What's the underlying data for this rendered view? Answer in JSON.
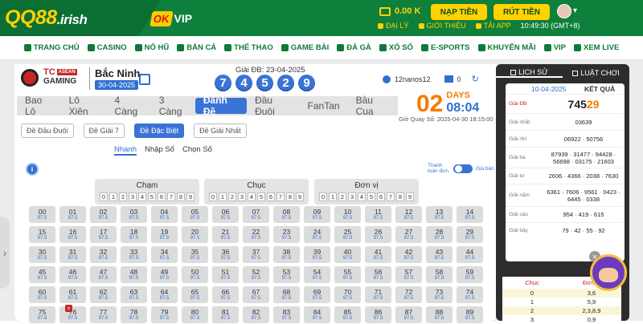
{
  "brand": {
    "name": "QQ88",
    "suffix": ".irish",
    "partner_ok": "OK",
    "partner_vip": "VIP"
  },
  "top": {
    "balance": "0.00 K",
    "deposit": "NẠP TIỀN",
    "withdraw": "RÚT TIỀN"
  },
  "subnav": {
    "agent": "ĐẠI LÝ",
    "intro": "GIỚI THIỆU",
    "app": "TẢI APP",
    "clock": "10:49:30 (GMT+8)"
  },
  "menu": [
    "TRANG CHỦ",
    "CASINO",
    "NỔ HŨ",
    "BẮN CÁ",
    "THỂ THAO",
    "GAME BÀI",
    "ĐÁ GÀ",
    "XỔ SỐ",
    "E-SPORTS",
    "KHUYẾN MÃI",
    "VIP",
    "XEM LIVE"
  ],
  "game": {
    "logo_tc": "TC",
    "logo_asean": "ASEAN",
    "logo_gaming": "GAMING",
    "province": "Bắc Ninh",
    "date": "30-04-2025",
    "prize_label": "Giải ĐB: 23-04-2025",
    "balls": [
      "7",
      "4",
      "5",
      "2",
      "9"
    ]
  },
  "user": {
    "name": "12nanos12",
    "balance": "0"
  },
  "tabs": [
    "Bao Lô",
    "Lô Xiên",
    "4 Càng",
    "3 Càng",
    "Đánh Đề",
    "Đầu Đuôi",
    "FanTan",
    "Bầu Cua"
  ],
  "active_tab": "Đánh Đề",
  "countdown": {
    "days": "02",
    "days_label": "DAYS",
    "time": "08:04",
    "draw_time": "Giờ Quay Số: 2025-04-30 18:15:00"
  },
  "bet_types": [
    "Đề Đầu Đuôi",
    "Đề Giải 7",
    "Đề Đặc Biệt",
    "Đề Giải Nhất"
  ],
  "modes": [
    "Nhanh",
    "Nhập Số",
    "Chọn Số"
  ],
  "info_icon": "i",
  "pay_toggle": {
    "left": "Thanh toán đơn",
    "right": "Giá bán"
  },
  "groups": [
    {
      "label": "Chạm"
    },
    {
      "label": "Chục"
    },
    {
      "label": "Đơn vị"
    }
  ],
  "digits": [
    "0",
    "1",
    "2",
    "3",
    "4",
    "5",
    "6",
    "7",
    "8",
    "9"
  ],
  "odds": "97.5",
  "x_badge": "x",
  "right": {
    "tab_history": "LỊCH SỬ",
    "tab_rules": "LUẬT CHƠI",
    "date": "10-04-2025",
    "result": "KẾT QUẢ"
  },
  "results": [
    {
      "label": "Giải ĐB",
      "value": "74529",
      "main": "745",
      "tail": "29"
    },
    {
      "label": "Giải nhất",
      "value": "03639"
    },
    {
      "label": "Giải nhì",
      "value": "06922 · 50756"
    },
    {
      "label": "Giải ba",
      "value": "87939 · 31477 · 94428 · 56698 · 03175 · 21603"
    },
    {
      "label": "Giải tư",
      "value": "2606 · 4366 · 2038 · 7630"
    },
    {
      "label": "Giải năm",
      "value": "6361 · 7606 · 9561 · 0423 · 6445 · 0338"
    },
    {
      "label": "Giải sáu",
      "value": "954 · 419 · 615"
    },
    {
      "label": "Giải bảy",
      "value": "79 · 42 · 55 · 92"
    }
  ],
  "summary": {
    "col1": "Chục",
    "col2": "Đơn vị",
    "rows": [
      [
        "0",
        "3,6"
      ],
      [
        "1",
        "5,9"
      ],
      [
        "2",
        "2,3,8,9"
      ],
      [
        "3",
        "0,9"
      ]
    ]
  },
  "colors": {
    "green": "#0f7f3c",
    "yellow": "#ffd200",
    "blue": "#3a73d6",
    "orange": "#f57c00"
  }
}
